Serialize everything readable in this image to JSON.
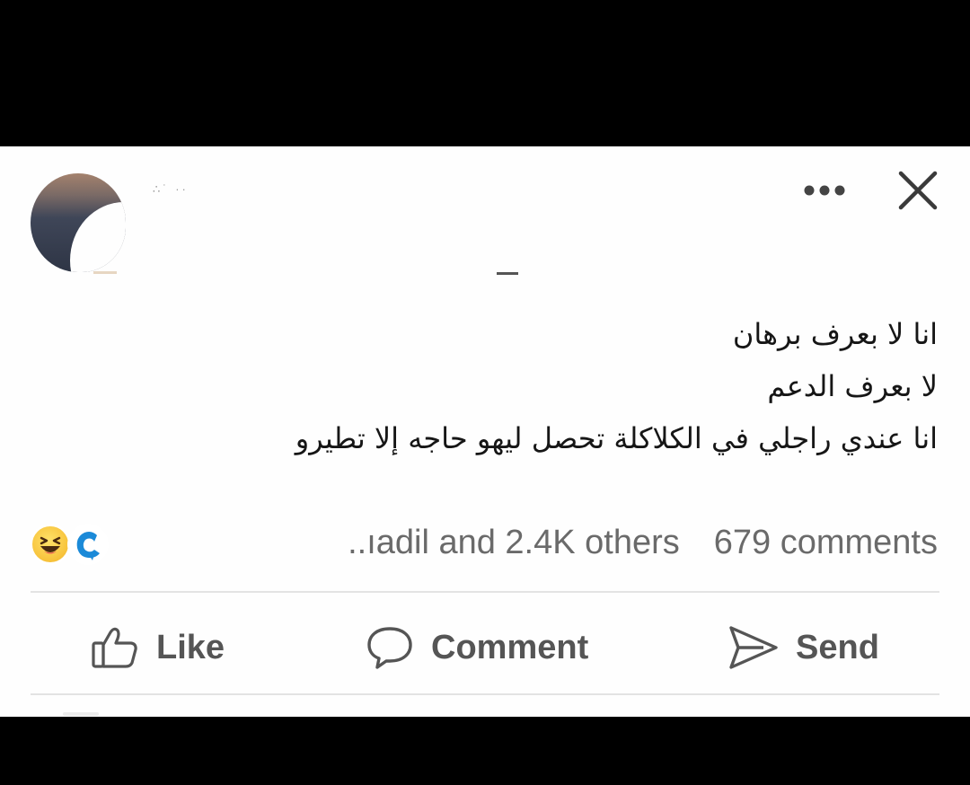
{
  "post": {
    "author_name_blurred": "∴˙ ··",
    "text_lines": [
      "انا لا بعرف برهان",
      "لا بعرف الدعم",
      "انا عندي راجلي في الكلاكلة تحصل ليهو حاجه إلا تطيرو"
    ]
  },
  "reactions": {
    "icons": [
      "haha-icon",
      "care-icon"
    ],
    "summary": "..ıadil and 2.4K others",
    "comments": "679 comments"
  },
  "actions": {
    "like": "Like",
    "comment": "Comment",
    "send": "Send"
  },
  "colors": {
    "background": "#000000",
    "card": "#fefefe",
    "text": "#161616",
    "muted": "#6a6a6a",
    "icon": "#555555"
  }
}
